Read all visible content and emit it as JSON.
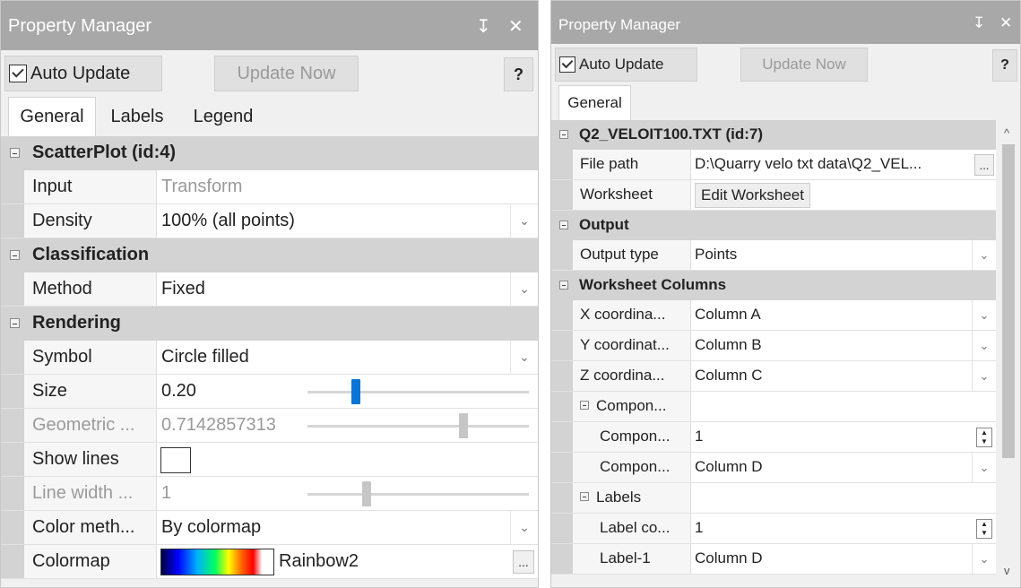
{
  "left": {
    "title": "Property Manager",
    "pin_glyph": "↧",
    "close_glyph": "✕",
    "auto_update_label": "Auto Update",
    "update_now_label": "Update Now",
    "help_label": "?",
    "tabs": [
      "General",
      "Labels",
      "Legend"
    ],
    "categories": {
      "scatter": "ScatterPlot (id:4)",
      "classification": "Classification",
      "rendering": "Rendering"
    },
    "rows": {
      "input": {
        "name": "Input",
        "value": "Transform"
      },
      "density": {
        "name": "Density",
        "value": "100% (all points)"
      },
      "method": {
        "name": "Method",
        "value": "Fixed"
      },
      "symbol": {
        "name": "Symbol",
        "value": "Circle filled"
      },
      "size": {
        "name": "Size",
        "value": "0.20"
      },
      "geometric": {
        "name": "Geometric ...",
        "value": "0.7142857313"
      },
      "show_lines": {
        "name": "Show lines"
      },
      "line_width": {
        "name": "Line width ...",
        "value": "1"
      },
      "color_method": {
        "name": "Color meth...",
        "value": "By colormap"
      },
      "colormap": {
        "name": "Colormap",
        "value": "Rainbow2"
      }
    },
    "ellipsis": "..."
  },
  "right": {
    "title": "Property Manager",
    "pin_glyph": "↧",
    "close_glyph": "✕",
    "auto_update_label": "Auto Update",
    "update_now_label": "Update Now",
    "help_label": "?",
    "tab": "General",
    "categories": {
      "file": "Q2_VELOIT100.TXT (id:7)",
      "output": "Output",
      "worksheet_columns": "Worksheet Columns"
    },
    "rows": {
      "file_path": {
        "name": "File path",
        "value": "D:\\Quarry velo txt data\\Q2_VEL..."
      },
      "worksheet": {
        "name": "Worksheet",
        "value": "Edit Worksheet"
      },
      "output_type": {
        "name": "Output type",
        "value": "Points"
      },
      "x_coord": {
        "name": "X coordina...",
        "value": "Column A"
      },
      "y_coord": {
        "name": "Y coordinat...",
        "value": "Column B"
      },
      "z_coord": {
        "name": "Z coordina...",
        "value": "Column C"
      },
      "component_group": {
        "name": "Compon..."
      },
      "component_count": {
        "name": "Compon...",
        "value": "1"
      },
      "component_1": {
        "name": "Compon...",
        "value": "Column D"
      },
      "labels_group": {
        "name": "Labels"
      },
      "label_count": {
        "name": "Label co...",
        "value": "1"
      },
      "label_1": {
        "name": "Label-1",
        "value": "Column D"
      }
    },
    "ellipsis": "...",
    "scroll_up_glyph": "^",
    "scroll_down_glyph": "v"
  }
}
